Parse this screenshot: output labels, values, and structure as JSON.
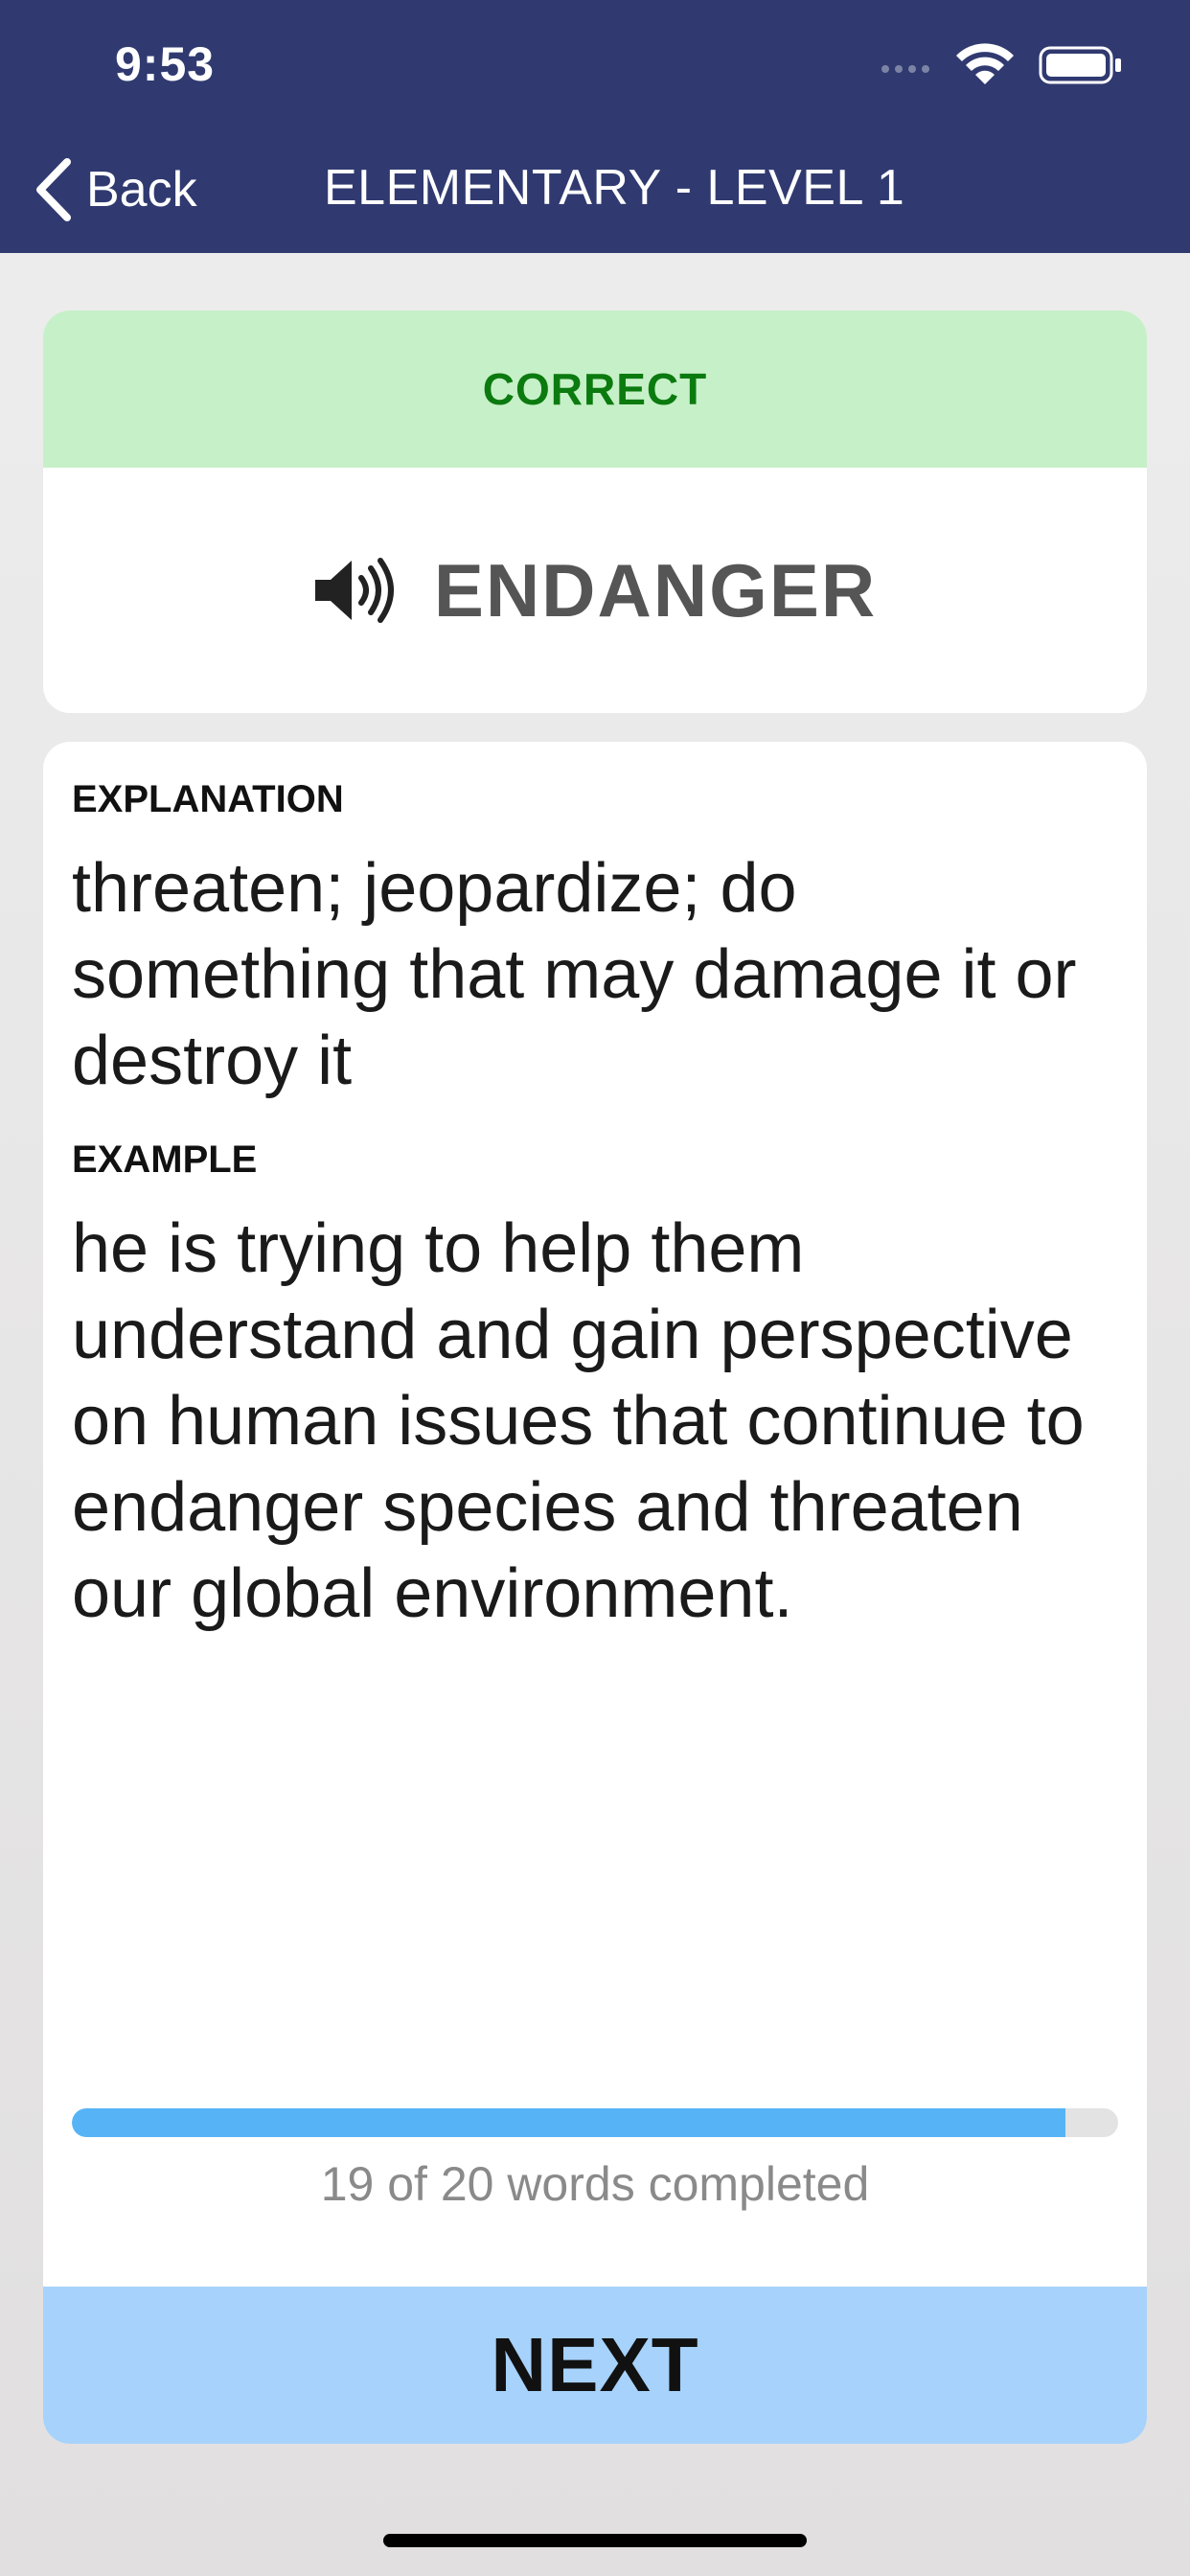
{
  "status_bar": {
    "time": "9:53",
    "icons": [
      "signal-icon",
      "wifi-icon",
      "battery-icon"
    ]
  },
  "nav": {
    "back_label": "Back",
    "title": "ELEMENTARY - LEVEL 1"
  },
  "result": {
    "label": "CORRECT",
    "color": "#0b7a0f",
    "background": "#c6f0c7"
  },
  "word": {
    "text": "ENDANGER",
    "icon": "speaker-icon"
  },
  "explanation": {
    "label": "EXPLANATION",
    "lines": [
      "threaten; jeopardize; do",
      "something that may damage it or",
      "destroy it"
    ]
  },
  "example": {
    "label": "EXAMPLE",
    "lines": [
      "he is trying to help them",
      "understand and gain perspective",
      "on human issues that continue to",
      "endanger species and threaten",
      "our global environment."
    ]
  },
  "progress": {
    "completed": 19,
    "total": 20,
    "label": "19 of 20 words completed",
    "color": "#56b4f6"
  },
  "next_button": {
    "label": "NEXT",
    "color": "#a6d2fb"
  },
  "theme": {
    "header": "#303a70"
  }
}
